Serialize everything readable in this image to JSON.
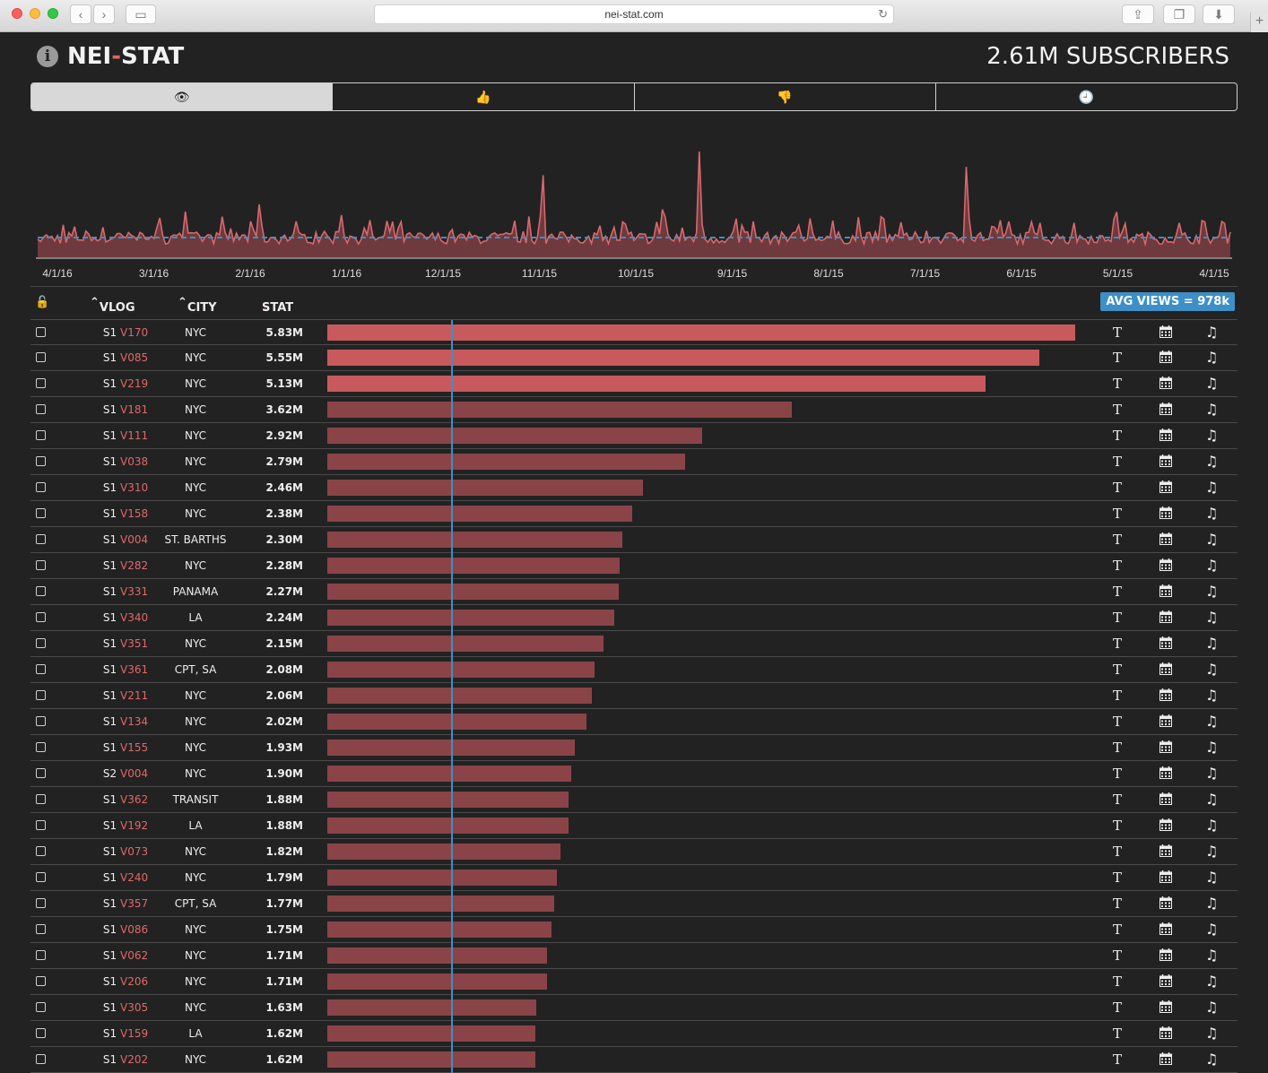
{
  "browser": {
    "url": "nei-stat.com"
  },
  "header": {
    "logo_left": "NEI",
    "logo_dash": "-",
    "logo_right": "STAT",
    "subscribers": "2.61M SUBSCRIBERS"
  },
  "tabs": [
    {
      "icon": "eye-icon",
      "glyph": "👁",
      "active": true
    },
    {
      "icon": "thumbs-up-icon",
      "glyph": "👍",
      "active": false
    },
    {
      "icon": "thumbs-down-icon",
      "glyph": "👎",
      "active": false
    },
    {
      "icon": "clock-icon",
      "glyph": "🕘",
      "active": false
    }
  ],
  "timeline": {
    "ticks": [
      "4/1/16",
      "3/1/16",
      "2/1/16",
      "1/1/16",
      "12/1/15",
      "11/1/15",
      "10/1/15",
      "9/1/15",
      "8/1/15",
      "7/1/15",
      "6/1/15",
      "5/1/15",
      "4/1/15"
    ],
    "colors": {
      "line": "#d9686c",
      "fill": "#6e3a3d",
      "avg": "#3d8fc6"
    }
  },
  "table": {
    "headers": {
      "vlog": "VLOG",
      "city": "CITY",
      "stat": "STAT",
      "avg": "AVG VIEWS = 978k"
    },
    "max_value": 5.83,
    "avg_value": 0.978,
    "rows": [
      {
        "season": "S1",
        "vid": "V170",
        "city": "NYC",
        "stat": "5.83M",
        "value": 5.83,
        "hi": true
      },
      {
        "season": "S1",
        "vid": "V085",
        "city": "NYC",
        "stat": "5.55M",
        "value": 5.55,
        "hi": true
      },
      {
        "season": "S1",
        "vid": "V219",
        "city": "NYC",
        "stat": "5.13M",
        "value": 5.13,
        "hi": true
      },
      {
        "season": "S1",
        "vid": "V181",
        "city": "NYC",
        "stat": "3.62M",
        "value": 3.62,
        "hi": false
      },
      {
        "season": "S1",
        "vid": "V111",
        "city": "NYC",
        "stat": "2.92M",
        "value": 2.92,
        "hi": false
      },
      {
        "season": "S1",
        "vid": "V038",
        "city": "NYC",
        "stat": "2.79M",
        "value": 2.79,
        "hi": false
      },
      {
        "season": "S1",
        "vid": "V310",
        "city": "NYC",
        "stat": "2.46M",
        "value": 2.46,
        "hi": false
      },
      {
        "season": "S1",
        "vid": "V158",
        "city": "NYC",
        "stat": "2.38M",
        "value": 2.38,
        "hi": false
      },
      {
        "season": "S1",
        "vid": "V004",
        "city": "ST. BARTHS",
        "stat": "2.30M",
        "value": 2.3,
        "hi": false
      },
      {
        "season": "S1",
        "vid": "V282",
        "city": "NYC",
        "stat": "2.28M",
        "value": 2.28,
        "hi": false
      },
      {
        "season": "S1",
        "vid": "V331",
        "city": "PANAMA",
        "stat": "2.27M",
        "value": 2.27,
        "hi": false
      },
      {
        "season": "S1",
        "vid": "V340",
        "city": "LA",
        "stat": "2.24M",
        "value": 2.24,
        "hi": false
      },
      {
        "season": "S1",
        "vid": "V351",
        "city": "NYC",
        "stat": "2.15M",
        "value": 2.15,
        "hi": false
      },
      {
        "season": "S1",
        "vid": "V361",
        "city": "CPT, SA",
        "stat": "2.08M",
        "value": 2.08,
        "hi": false
      },
      {
        "season": "S1",
        "vid": "V211",
        "city": "NYC",
        "stat": "2.06M",
        "value": 2.06,
        "hi": false
      },
      {
        "season": "S1",
        "vid": "V134",
        "city": "NYC",
        "stat": "2.02M",
        "value": 2.02,
        "hi": false
      },
      {
        "season": "S1",
        "vid": "V155",
        "city": "NYC",
        "stat": "1.93M",
        "value": 1.93,
        "hi": false
      },
      {
        "season": "S2",
        "vid": "V004",
        "city": "NYC",
        "stat": "1.90M",
        "value": 1.9,
        "hi": false
      },
      {
        "season": "S1",
        "vid": "V362",
        "city": "TRANSIT",
        "stat": "1.88M",
        "value": 1.88,
        "hi": false
      },
      {
        "season": "S1",
        "vid": "V192",
        "city": "LA",
        "stat": "1.88M",
        "value": 1.88,
        "hi": false
      },
      {
        "season": "S1",
        "vid": "V073",
        "city": "NYC",
        "stat": "1.82M",
        "value": 1.82,
        "hi": false
      },
      {
        "season": "S1",
        "vid": "V240",
        "city": "NYC",
        "stat": "1.79M",
        "value": 1.79,
        "hi": false
      },
      {
        "season": "S1",
        "vid": "V357",
        "city": "CPT, SA",
        "stat": "1.77M",
        "value": 1.77,
        "hi": false
      },
      {
        "season": "S1",
        "vid": "V086",
        "city": "NYC",
        "stat": "1.75M",
        "value": 1.75,
        "hi": false
      },
      {
        "season": "S1",
        "vid": "V062",
        "city": "NYC",
        "stat": "1.71M",
        "value": 1.71,
        "hi": false
      },
      {
        "season": "S1",
        "vid": "V206",
        "city": "NYC",
        "stat": "1.71M",
        "value": 1.71,
        "hi": false
      },
      {
        "season": "S1",
        "vid": "V305",
        "city": "NYC",
        "stat": "1.63M",
        "value": 1.63,
        "hi": false
      },
      {
        "season": "S1",
        "vid": "V159",
        "city": "LA",
        "stat": "1.62M",
        "value": 1.62,
        "hi": false
      },
      {
        "season": "S1",
        "vid": "V202",
        "city": "NYC",
        "stat": "1.62M",
        "value": 1.62,
        "hi": false
      }
    ],
    "row_icons": {
      "transcript": "T",
      "calendar": "calendar-icon",
      "music": "♫"
    }
  }
}
